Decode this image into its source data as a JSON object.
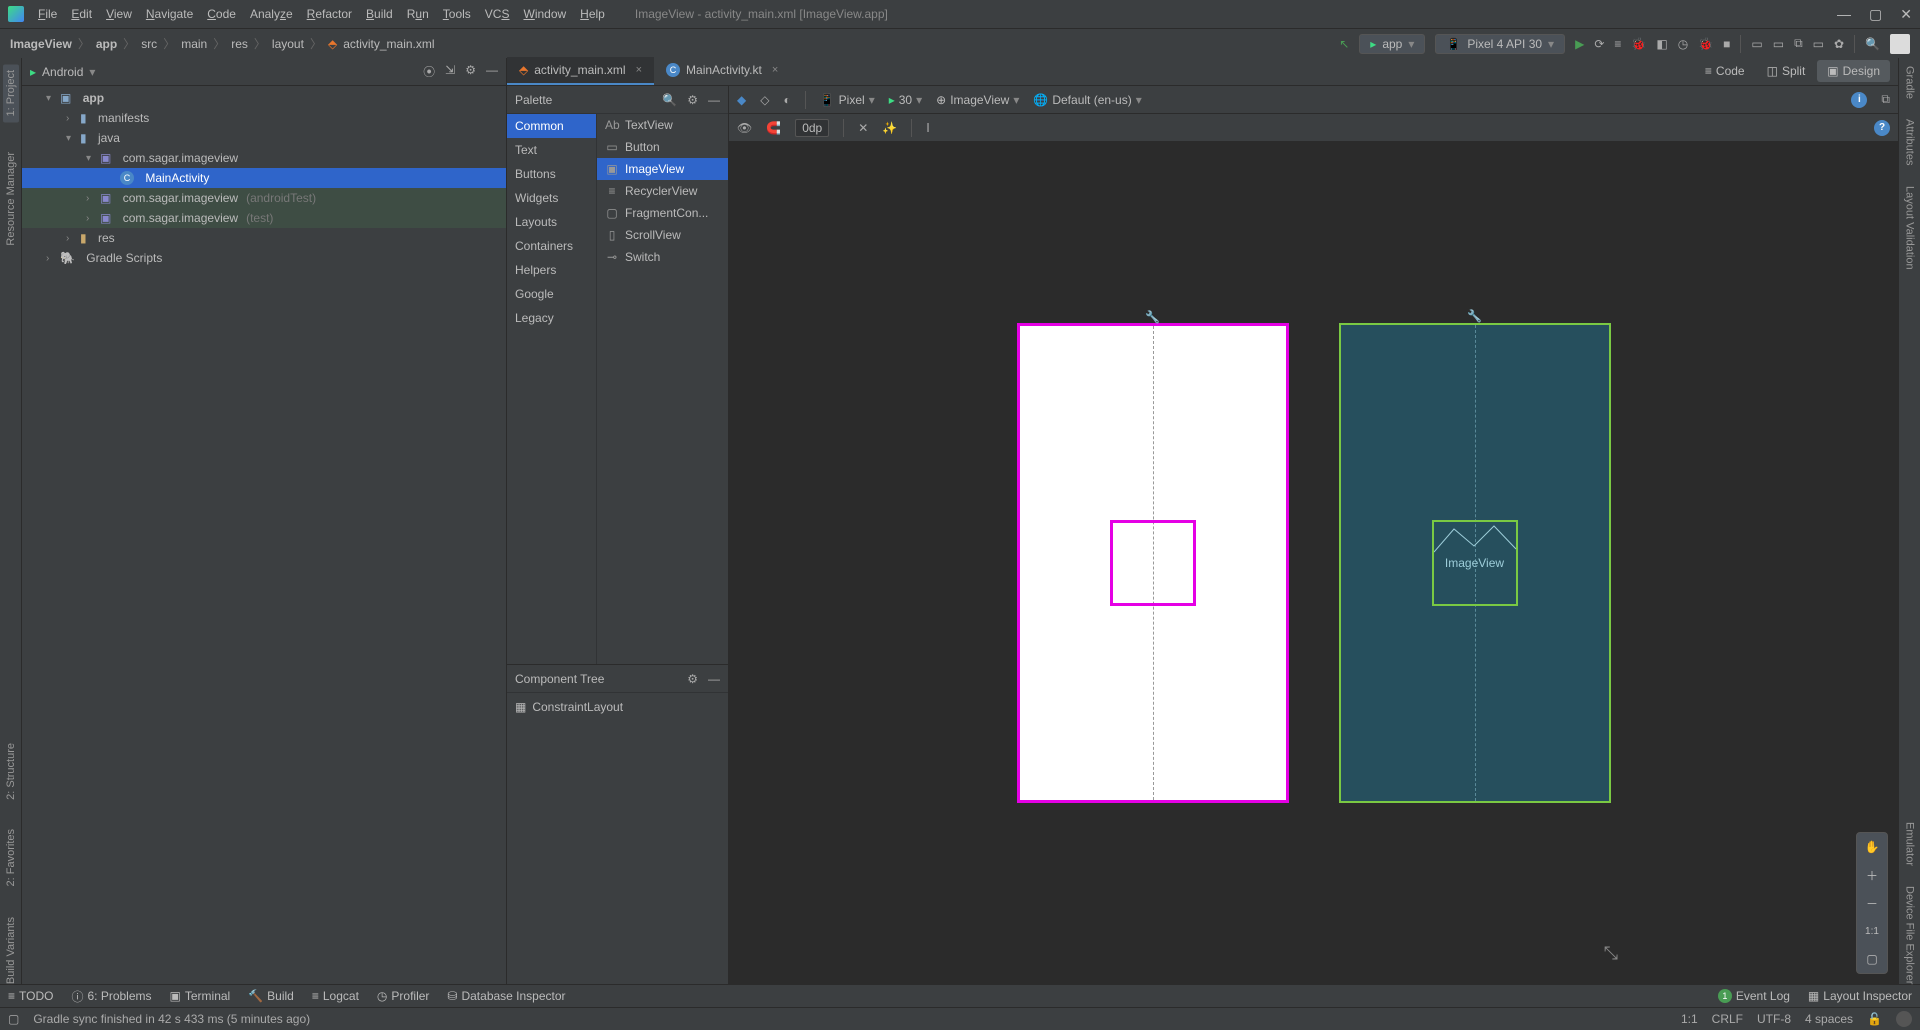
{
  "titlebar": {
    "menu": [
      "File",
      "Edit",
      "View",
      "Navigate",
      "Code",
      "Analyze",
      "Refactor",
      "Build",
      "Run",
      "Tools",
      "VCS",
      "Window",
      "Help"
    ],
    "title": "ImageView - activity_main.xml [ImageView.app]"
  },
  "breadcrumb": {
    "items": [
      "ImageView",
      "app",
      "src",
      "main",
      "res",
      "layout",
      "activity_main.xml"
    ]
  },
  "run": {
    "config": "app",
    "device": "Pixel 4 API 30"
  },
  "project": {
    "title": "Android",
    "root": "app",
    "nodes": {
      "manifests": "manifests",
      "java": "java",
      "pkg1": "com.sagar.imageview",
      "main_activity": "MainActivity",
      "pkg2": "com.sagar.imageview",
      "pkg2_suffix": "(androidTest)",
      "pkg3": "com.sagar.imageview",
      "pkg3_suffix": "(test)",
      "res": "res",
      "gradle": "Gradle Scripts"
    }
  },
  "editor_tabs": [
    {
      "label": "activity_main.xml",
      "active": true,
      "type": "xml"
    },
    {
      "label": "MainActivity.kt",
      "active": false,
      "type": "kt"
    }
  ],
  "view_modes": {
    "code": "Code",
    "split": "Split",
    "design": "Design"
  },
  "palette": {
    "title": "Palette",
    "categories": [
      "Common",
      "Text",
      "Buttons",
      "Widgets",
      "Layouts",
      "Containers",
      "Helpers",
      "Google",
      "Legacy"
    ],
    "items": [
      "TextView",
      "Button",
      "ImageView",
      "RecyclerView",
      "FragmentCon...",
      "ScrollView",
      "Switch"
    ]
  },
  "component_tree": {
    "title": "Component Tree",
    "root": "ConstraintLayout"
  },
  "canvas_toolbar": {
    "device": "Pixel",
    "api": "30",
    "theme": "ImageView",
    "locale": "Default (en-us)",
    "margin": "0dp"
  },
  "blueprint": {
    "label": "ImageView"
  },
  "left_strips": [
    "1: Project",
    "Resource Manager",
    "2: Structure",
    "2: Favorites",
    "Build Variants"
  ],
  "right_strips": [
    "Gradle",
    "Attributes",
    "Layout Validation",
    "Emulator",
    "Device File Explorer"
  ],
  "bottom_tools": {
    "items": [
      "TODO",
      "6: Problems",
      "Terminal",
      "Build",
      "Logcat",
      "Profiler",
      "Database Inspector"
    ],
    "event_log": "Event Log",
    "layout_inspector": "Layout Inspector",
    "event_badge": "1"
  },
  "status": {
    "message": "Gradle sync finished in 42 s 433 ms (5 minutes ago)",
    "caret": "1:1",
    "line_ending": "CRLF",
    "encoding": "UTF-8",
    "indent": "4 spaces"
  }
}
